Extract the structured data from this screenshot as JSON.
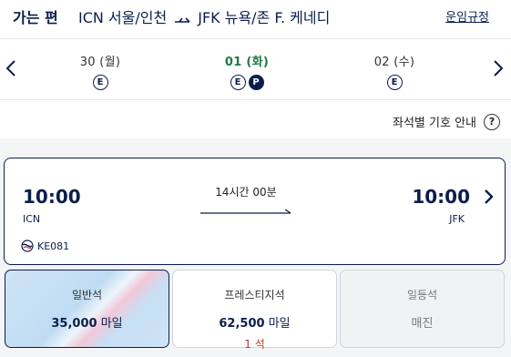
{
  "header": {
    "direction": "가는 편",
    "origin": "ICN 서울/인천",
    "destination": "JFK 뉴욕/존 F. 케네디",
    "fare_rules": "운임규정"
  },
  "dates": [
    {
      "label": "30 (월)",
      "badges": [
        "E"
      ],
      "selected": false
    },
    {
      "label": "01 (화)",
      "badges": [
        "E",
        "P"
      ],
      "selected": true
    },
    {
      "label": "02 (수)",
      "badges": [
        "E"
      ],
      "selected": false
    }
  ],
  "legend": {
    "label": "좌석별 기호 안내",
    "icon": "?"
  },
  "flight": {
    "dep_time": "10:00",
    "dep_code": "ICN",
    "arr_time": "10:00",
    "arr_code": "JFK",
    "duration": "14시간 00분",
    "flight_no": "KE081"
  },
  "fares": [
    {
      "class": "일반석",
      "miles_value": "35,000",
      "miles_unit": "마일",
      "seats": ""
    },
    {
      "class": "프레스티지석",
      "miles_value": "62,500",
      "miles_unit": "마일",
      "seats": "1 석"
    },
    {
      "class": "일등석",
      "status": "매진"
    }
  ],
  "colors": {
    "navy": "#0a1e4b",
    "selected_green": "#1d7a45",
    "seat_red": "#c0392b"
  }
}
